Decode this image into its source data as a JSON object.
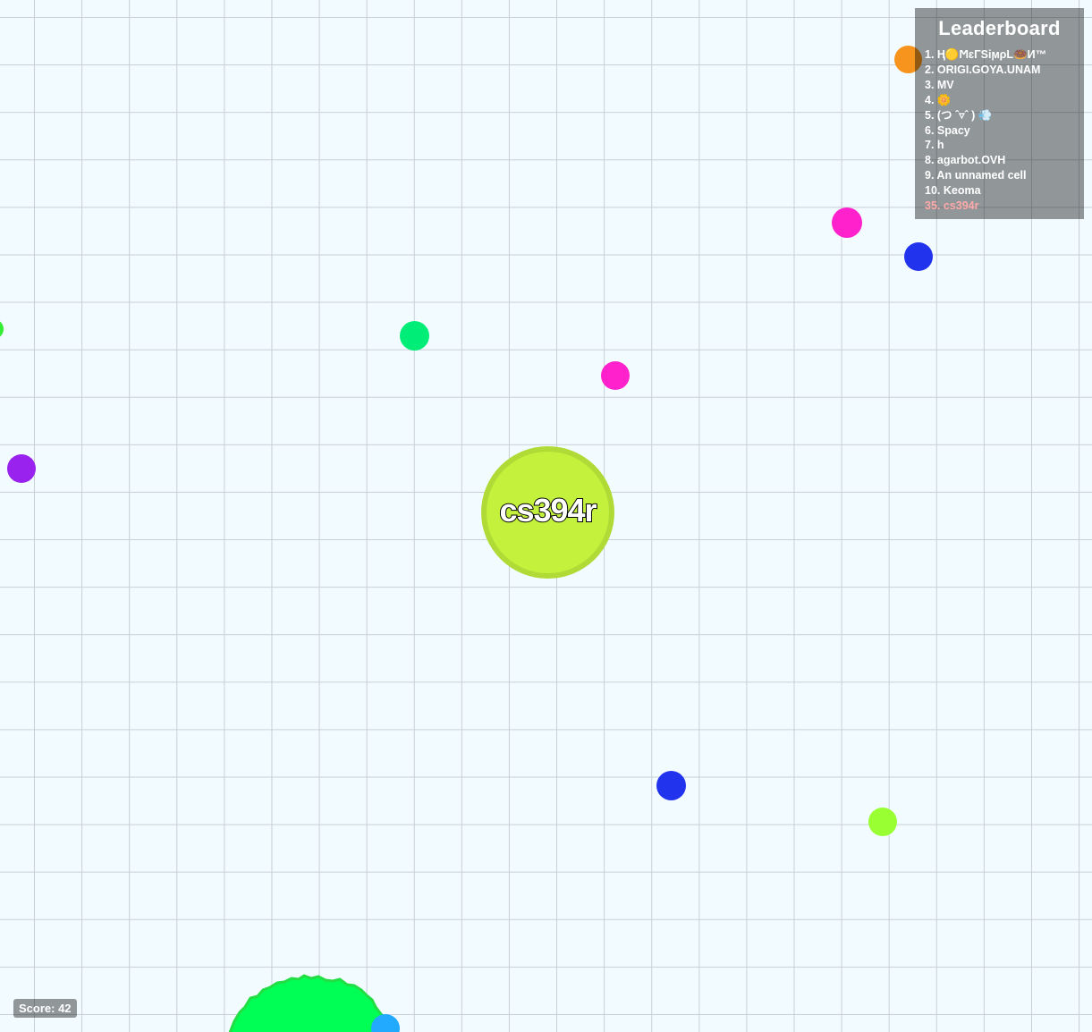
{
  "leaderboard": {
    "title": "Leaderboard",
    "entries": [
      "1. Ң🟡ϺɛΓSiϻρL🍩И™",
      "2. ORIGI.GOYA.UNAM",
      "3. MV",
      "4. 🌼",
      "5. (つ ˆ▿ˆ ) 💨",
      "6. Spacy",
      "7. h",
      "8. agarbot.OVH",
      "9. An unnamed cell",
      "10. Keoma"
    ],
    "own_entry": "35. cs394r"
  },
  "score": {
    "text": "Score: 42"
  },
  "player": {
    "name": "cs394r",
    "color": "#c4f23c",
    "border_color": "#b0da36"
  },
  "colors": {
    "background": "#f2fbff",
    "grid": "#c8d0d6",
    "pellet_orange": "#ff9922",
    "pellet_magenta": "#ff22cc",
    "pellet_blue": "#2233ee",
    "pellet_green": "#00ee77",
    "pellet_purple": "#9922ee",
    "pellet_lime": "#99ff33",
    "virus": "#00ff55",
    "pellet_cyan": "#22aaff"
  }
}
